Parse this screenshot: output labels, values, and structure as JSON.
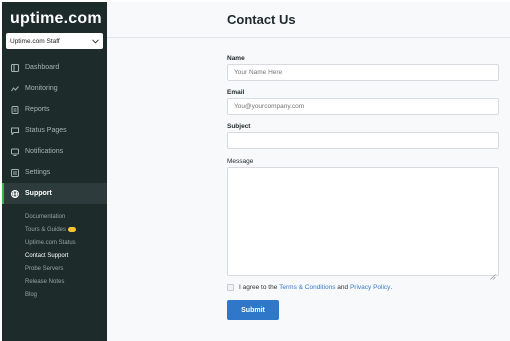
{
  "brand": {
    "logo": "uptime.com",
    "accent": "#3bb34a"
  },
  "account": {
    "label": "Uptime.com Staff"
  },
  "nav": [
    {
      "label": "Dashboard",
      "icon": "dashboard-icon"
    },
    {
      "label": "Monitoring",
      "icon": "monitoring-icon"
    },
    {
      "label": "Reports",
      "icon": "reports-icon"
    },
    {
      "label": "Status Pages",
      "icon": "status-pages-icon"
    },
    {
      "label": "Notifications",
      "icon": "notifications-icon"
    },
    {
      "label": "Settings",
      "icon": "settings-icon"
    },
    {
      "label": "Support",
      "icon": "globe-icon",
      "active": true
    }
  ],
  "subnav": [
    {
      "label": "Documentation"
    },
    {
      "label": "Tours & Guides",
      "badge": true
    },
    {
      "label": "Uptime.com Status"
    },
    {
      "label": "Contact Support",
      "current": true
    },
    {
      "label": "Probe Servers"
    },
    {
      "label": "Release Notes"
    },
    {
      "label": "Blog"
    }
  ],
  "page": {
    "title": "Contact Us"
  },
  "form": {
    "name_label": "Name",
    "name_placeholder": "Your Name Here",
    "email_label": "Email",
    "email_placeholder": "You@yourcompany.com",
    "subject_label": "Subject",
    "message_label": "Message",
    "agree_prefix": "I agree to the ",
    "terms_link": "Terms & Conditions",
    "agree_and": " and ",
    "privacy_link": "Privacy Policy",
    "agree_suffix": ".",
    "submit_label": "Submit"
  },
  "colors": {
    "sidebar_bg": "#1e2b2b",
    "primary_button": "#2f78c9",
    "link": "#3a7ac8"
  }
}
